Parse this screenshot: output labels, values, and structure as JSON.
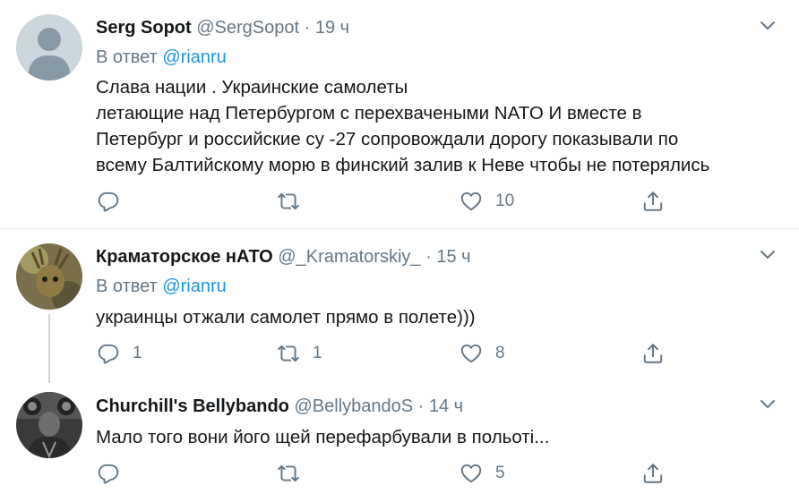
{
  "tweets": [
    {
      "name": "Serg Sopot",
      "handle": "@SergSopot",
      "dot": "·",
      "time": "19 ч",
      "reply_prefix": "В ответ",
      "reply_mention": "@rianru",
      "text": "Слава нации . Украинские самолеты\nлетающие над Петербургом с перехвачеными NATO И вместе в\nПетербург и российские су -27 сопровождали дорогу показывали по\nвсему Балтийскому морю в финский залив  к Неве чтобы не потерялись",
      "replies": "",
      "retweets": "",
      "likes": "10"
    },
    {
      "name": "Краматорское нАТО",
      "handle": "@_Kramatorskiy_",
      "dot": "·",
      "time": "15 ч",
      "reply_prefix": "В ответ",
      "reply_mention": "@rianru",
      "text": "украинцы отжали самолет прямо в полете)))",
      "replies": "1",
      "retweets": "1",
      "likes": "8"
    },
    {
      "name": "Churchill's Bellybando",
      "handle": "@BellybandoS",
      "dot": "·",
      "time": "14 ч",
      "text": "Мало того вони його щей перефарбували в польоті...",
      "replies": "",
      "retweets": "",
      "likes": "5"
    }
  ],
  "colors": {
    "accent": "#1b95e0",
    "secondary": "#657786",
    "divider": "#e6ecf0"
  },
  "icons": {
    "reply": "reply-icon",
    "retweet": "retweet-icon",
    "like": "heart-icon",
    "share": "share-icon",
    "caret": "chevron-down-icon"
  }
}
